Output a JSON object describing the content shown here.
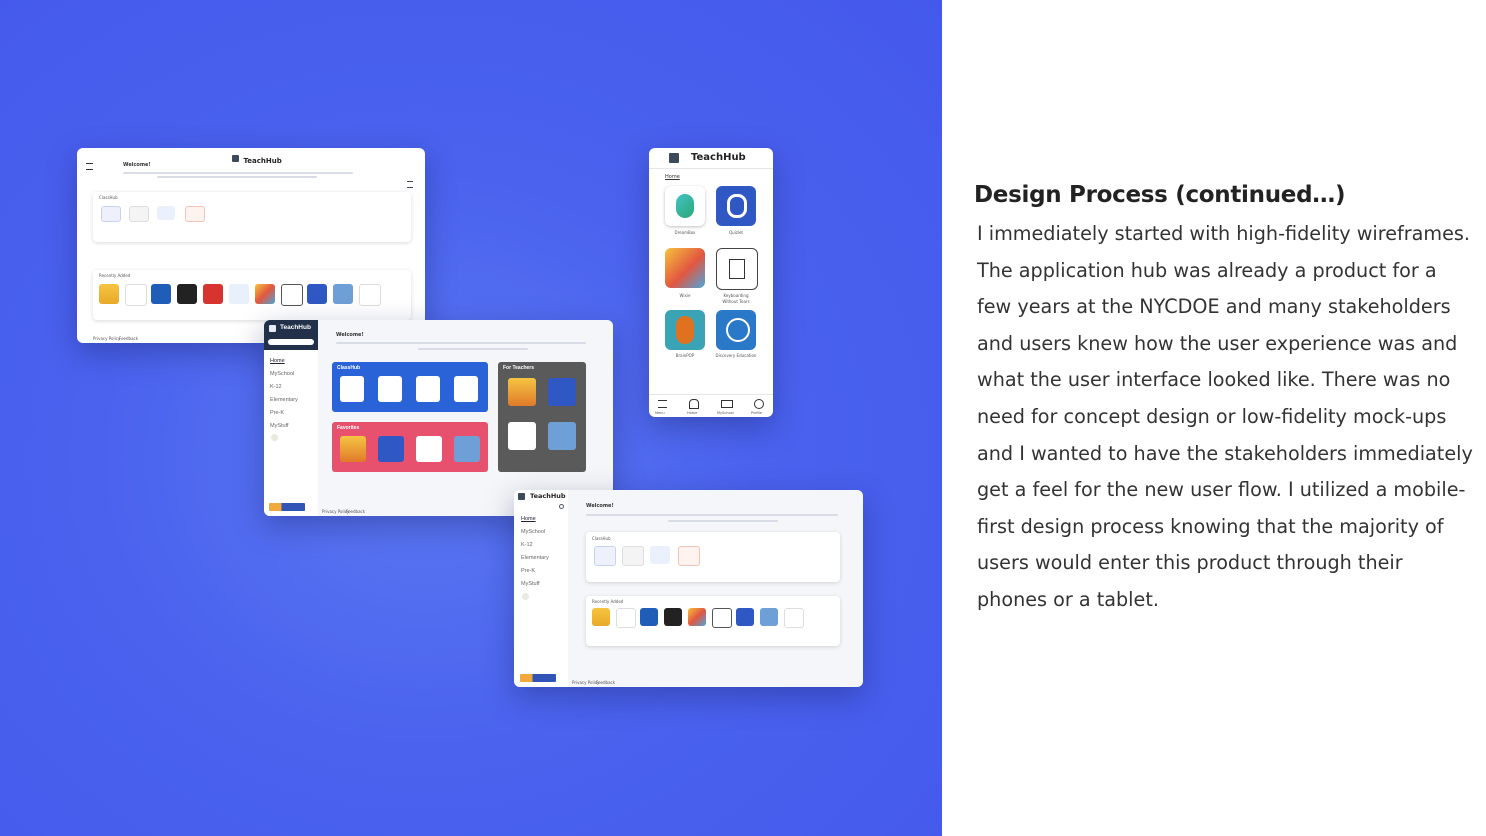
{
  "slide": {
    "heading": "Design Process (continued…)",
    "paragraph": "I immediately started with high-fidelity wireframes. The application hub was already a product for a few years at the NYCDOE and many stakeholders and users knew how the user experience was and what the user interface looked like. There was no need for concept design or low-fidelity mock-ups and I wanted to have the stakeholders immediately get a feel for the new user flow. I utilized a mobile-first design process knowing that the majority of users would enter this product through their phones or a tablet."
  },
  "colors": {
    "background_blue": "#4a62ee",
    "classhub_blue": "#2a63d8",
    "favorites_red": "#e8516e",
    "teachers_gray": "#5a5a5a"
  },
  "mock_desktop1": {
    "brand": "TeachHub",
    "welcome": "Welcome!",
    "classhub_label": "ClassHub",
    "recent_label": "Recently Added",
    "footer_privacy": "Privacy Policy",
    "footer_feedback": "Feedback"
  },
  "mock_desktop2": {
    "brand": "TeachHub",
    "welcome": "Welcome!",
    "nav": [
      "Home",
      "MySchool",
      "K-12",
      "Elementary",
      "Pre-K",
      "MyStuff"
    ],
    "classhub_label": "ClassHub",
    "favorites_label": "Favorites",
    "teachers_label": "For Teachers",
    "footer_privacy": "Privacy Policy",
    "footer_feedback": "Feedback"
  },
  "mock_mobile": {
    "brand": "TeachHub",
    "home": "Home",
    "apps": [
      "DreamBox",
      "Quizlet",
      "Wixie",
      "Keyboarding Without Tears",
      "BrainPOP",
      "Discovery Education"
    ],
    "tabbar": [
      "Menu",
      "Home",
      "MySchool",
      "Profile"
    ]
  },
  "mock_desktop3": {
    "brand": "TeachHub",
    "welcome": "Welcome!",
    "nav": [
      "Home",
      "MySchool",
      "K-12",
      "Elementary",
      "Pre-K",
      "MyStuff"
    ],
    "classhub_label": "ClassHub",
    "recent_label": "Recently Added",
    "footer_privacy": "Privacy Policy",
    "footer_feedback": "Feedback"
  }
}
